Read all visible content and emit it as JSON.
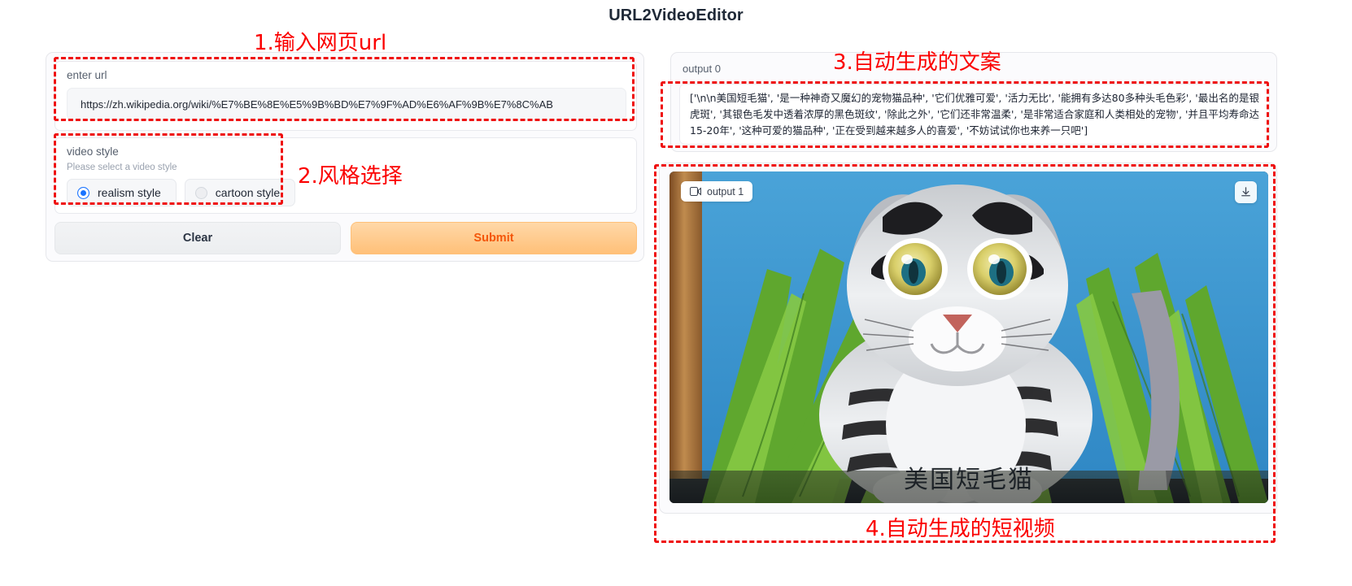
{
  "app": {
    "title": "URL2VideoEditor"
  },
  "form": {
    "url_field": {
      "label": "enter url",
      "value": "https://zh.wikipedia.org/wiki/%E7%BE%8E%E5%9B%BD%E7%9F%AD%E6%AF%9B%E7%8C%AB",
      "placeholder": "enter url"
    },
    "style_field": {
      "label": "video style",
      "hint": "Please select a video style",
      "options": [
        {
          "label": "realism style",
          "selected": true
        },
        {
          "label": "cartoon style",
          "selected": false
        }
      ]
    },
    "buttons": {
      "clear": "Clear",
      "submit": "Submit"
    }
  },
  "output_text": {
    "label": "output 0",
    "content": "['\\n\\n美国短毛猫', '是一种神奇又魔幻的宠物猫品种', '它们优雅可爱', '活力无比', '能拥有多达80多种头毛色彩', '最出名的是银虎斑', '其银色毛发中透着浓厚的黑色斑纹', '除此之外', '它们还非常温柔', '是非常适合家庭和人类相处的宠物', '并且平均寿命达15-20年', '这种可爱的猫品种', '正在受到越来越多人的喜爱', '不妨试试你也来养一只吧']"
  },
  "output_video": {
    "label": "output 1",
    "caption": "美国短毛猫",
    "download_icon": "download-icon",
    "video_icon": "video-camera-icon"
  },
  "annotations": [
    {
      "id": "a1",
      "text": "1.输入网页url"
    },
    {
      "id": "a2",
      "text": "2.风格选择"
    },
    {
      "id": "a3",
      "text": "3.自动生成的文案"
    },
    {
      "id": "a4",
      "text": "4.自动生成的短视频"
    }
  ],
  "colors": {
    "annotation": "#fb0000",
    "submit_text": "#f4560a",
    "radio_selected": "#1a73ff"
  }
}
